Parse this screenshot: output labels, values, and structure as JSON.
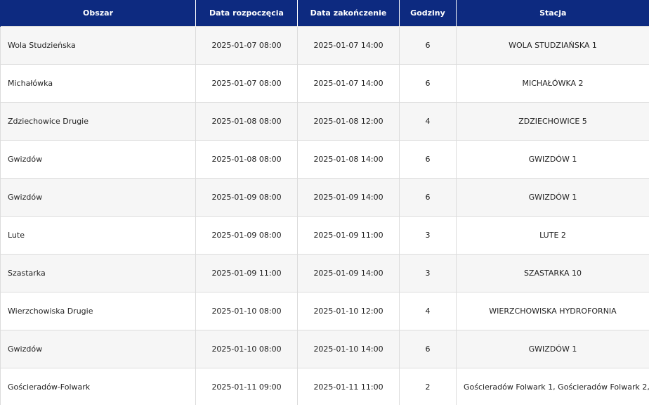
{
  "header": {
    "area": "Obszar",
    "start": "Data rozpoczęcia",
    "end": "Data zakończenie",
    "hours": "Godziny",
    "station": "Stacja"
  },
  "rows": [
    {
      "area": "Wola Studzieńska",
      "start": "2025-01-07 08:00",
      "end": "2025-01-07 14:00",
      "hours": "6",
      "station": "WOLA STUDZIAŃSKA 1"
    },
    {
      "area": "Michałówka",
      "start": "2025-01-07 08:00",
      "end": "2025-01-07 14:00",
      "hours": "6",
      "station": "MICHAŁÓWKA 2"
    },
    {
      "area": "Zdziechowice Drugie",
      "start": "2025-01-08 08:00",
      "end": "2025-01-08 12:00",
      "hours": "4",
      "station": "ZDZIECHOWICE 5"
    },
    {
      "area": "Gwizdów",
      "start": "2025-01-08 08:00",
      "end": "2025-01-08 14:00",
      "hours": "6",
      "station": "GWIZDÓW 1"
    },
    {
      "area": "Gwizdów",
      "start": "2025-01-09 08:00",
      "end": "2025-01-09 14:00",
      "hours": "6",
      "station": "GWIZDÓW 1"
    },
    {
      "area": "Lute",
      "start": "2025-01-09 08:00",
      "end": "2025-01-09 11:00",
      "hours": "3",
      "station": "LUTE 2"
    },
    {
      "area": "Szastarka",
      "start": "2025-01-09 11:00",
      "end": "2025-01-09 14:00",
      "hours": "3",
      "station": "SZASTARKA 10"
    },
    {
      "area": "Wierzchowiska Drugie",
      "start": "2025-01-10 08:00",
      "end": "2025-01-10 12:00",
      "hours": "4",
      "station": "WIERZCHOWISKA HYDROFORNIA"
    },
    {
      "area": "Gwizdów",
      "start": "2025-01-10 08:00",
      "end": "2025-01-10 14:00",
      "hours": "6",
      "station": "GWIZDÓW 1"
    },
    {
      "area": "Gościeradów-Folwark",
      "start": "2025-01-11 09:00",
      "end": "2025-01-11 11:00",
      "hours": "2",
      "station": "Gościeradów Folwark 1, Gościeradów Folwark 2,"
    }
  ]
}
